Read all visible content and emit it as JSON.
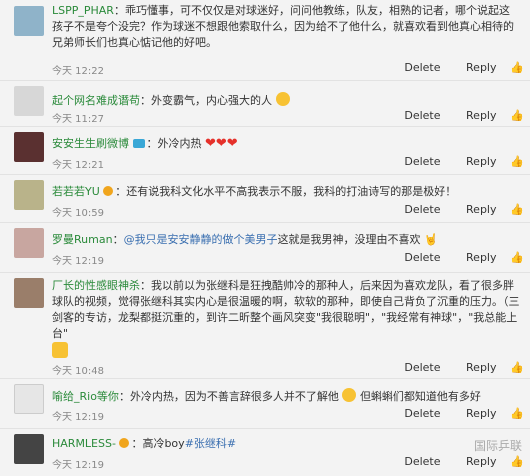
{
  "actions": {
    "delete": "Delete",
    "reply": "Reply"
  },
  "comments": [
    {
      "user": "LSPP_PHAR",
      "sep": "：",
      "text": "乖巧懂事，可不仅仅是对球迷好，问问他教练，队友，相熟的记者，哪个说起这孩子不是夸个没完？作为球迷不想跟他索取什么，因为给不了他什么，就喜欢看到他真心相待的兄弟师长们也真心惦记他的好吧。",
      "time": "今天 12:22"
    },
    {
      "user": "起个网名难成谮苟",
      "sep": "：",
      "text": "外变霸气，内心强大的人",
      "time": "今天 11:27"
    },
    {
      "user": "安安生生刷微博",
      "sep": "：",
      "text": "外冷内热",
      "time": "今天 12:21"
    },
    {
      "user": "若若若YU",
      "sep": "：",
      "text": "还有说我科文化水平不高我表示不服，我科的打油诗写的那是极好！",
      "time": "今天 10:59"
    },
    {
      "user": "罗曼Ruman",
      "sep": "：",
      "mention": "@我只是安安静静的做个美男子",
      "text": "这就是我男神，没理由不喜欢",
      "time": "今天 12:19"
    },
    {
      "user": "厂长的性感眼神杀",
      "sep": "：",
      "text": "我以前以为张继科是狂拽酷帅冷的那种人，后来因为喜欢龙队，看了很多胖球队的视频，觉得张继科其实内心是很温暖的啊，软软的那种，即使自己背负了沉重的压力。（三剑客的专访，龙梨都挺沉重的，到许二昕整个画风突变\"我很聪明\"，\"我经常有神球\"，\"我总能上台\"",
      "time": "今天 10:48"
    },
    {
      "user": "喻给_Rio等你",
      "sep": "：",
      "text": "外冷内热，因为不善言辞很多人并不了解他",
      "text2": "但蝌蝌们都知道他有多好",
      "time": "今天 12:19"
    },
    {
      "user": "HARMLESS-",
      "sep": "：",
      "text": "高冷boy",
      "tag": "#张继科#",
      "time": "今天 12:19"
    }
  ],
  "watermark": "国际乒联",
  "colors": {
    "username_green": "#2a8a3a",
    "username_blue": "#3a6fb0",
    "heart": "#e5302a"
  }
}
